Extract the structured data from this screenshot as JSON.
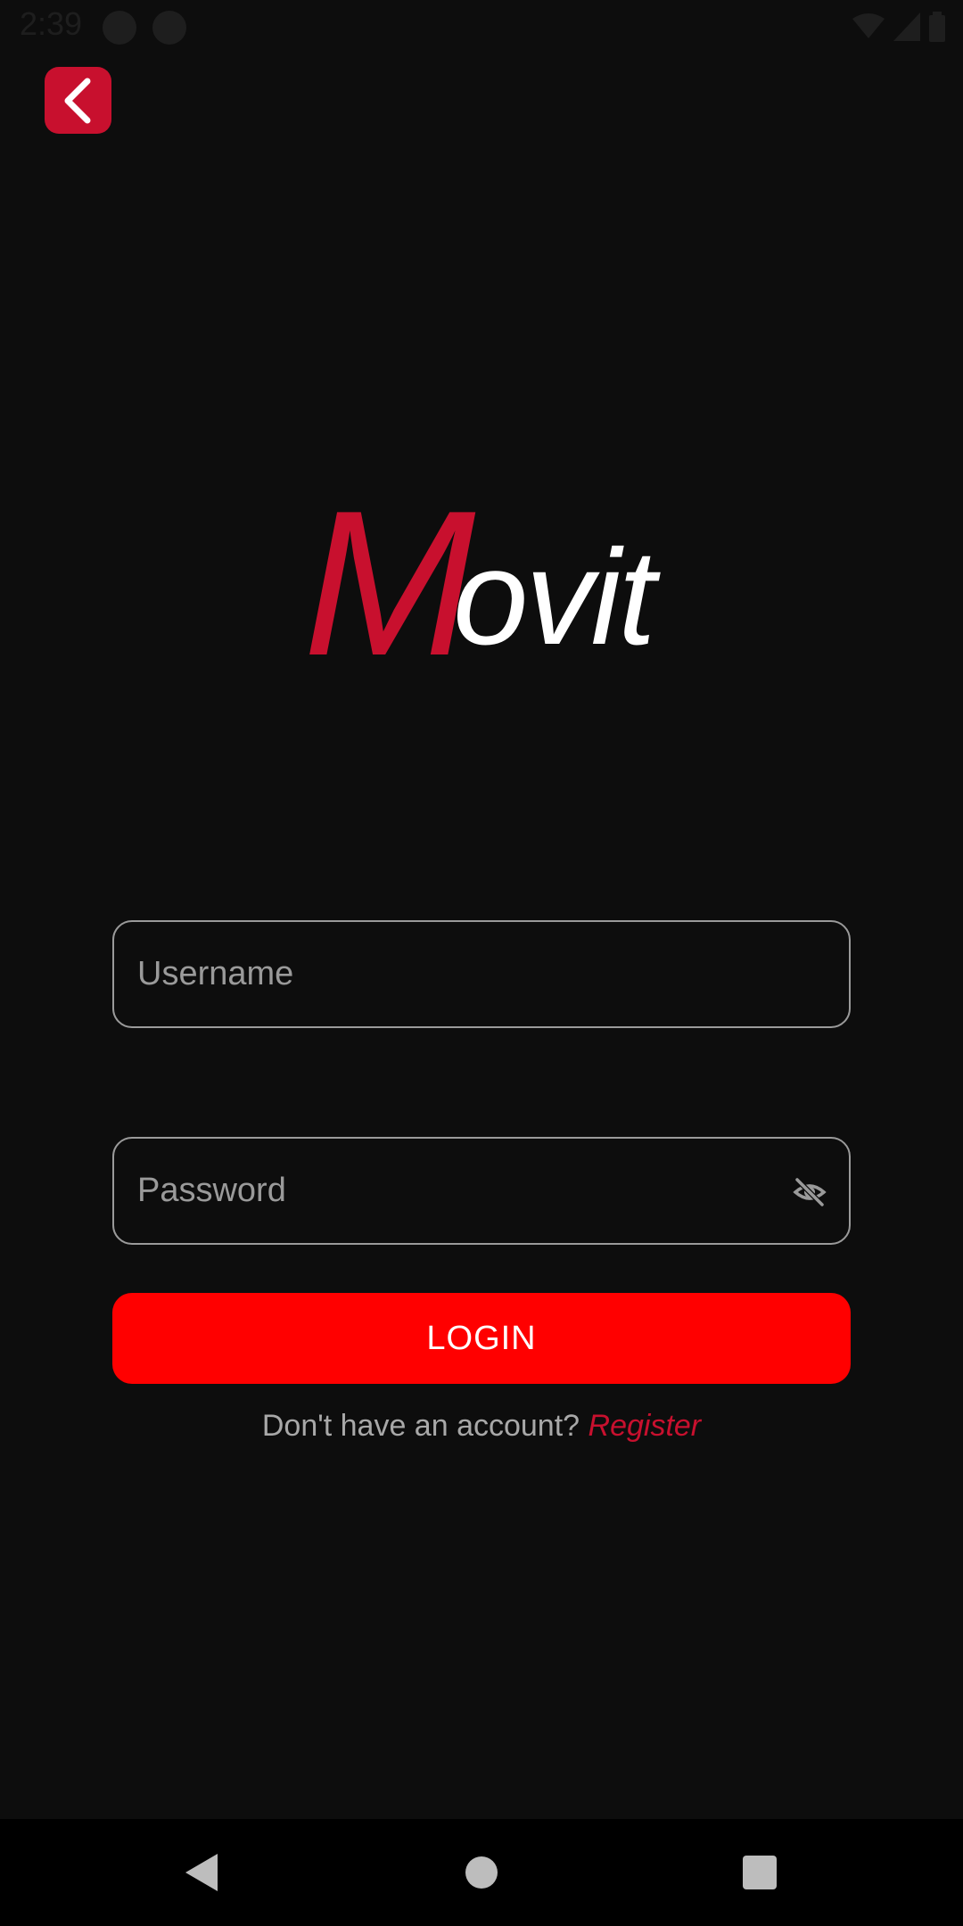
{
  "status_bar": {
    "time": "2:39",
    "icons": [
      "notification-a-icon",
      "half-circle-icon",
      "wifi-icon",
      "signal-icon",
      "battery-icon"
    ]
  },
  "header": {
    "back_icon": "chevron-left-icon"
  },
  "logo": {
    "initial": "M",
    "rest": "ovit"
  },
  "form": {
    "username": {
      "placeholder": "Username",
      "value": ""
    },
    "password": {
      "placeholder": "Password",
      "value": "",
      "toggle_icon": "eye-off-icon"
    },
    "login_label": "LOGIN",
    "register_prompt": "Don't have an account?",
    "register_link": "Register"
  },
  "nav_bar": {
    "buttons": [
      "back-triangle-icon",
      "home-circle-icon",
      "recents-square-icon"
    ]
  },
  "colors": {
    "background": "#0d0d0d",
    "accent": "#c8102e",
    "login_button": "#ff0000",
    "field_border": "#9a9a9a",
    "placeholder": "#9a9a9a"
  }
}
